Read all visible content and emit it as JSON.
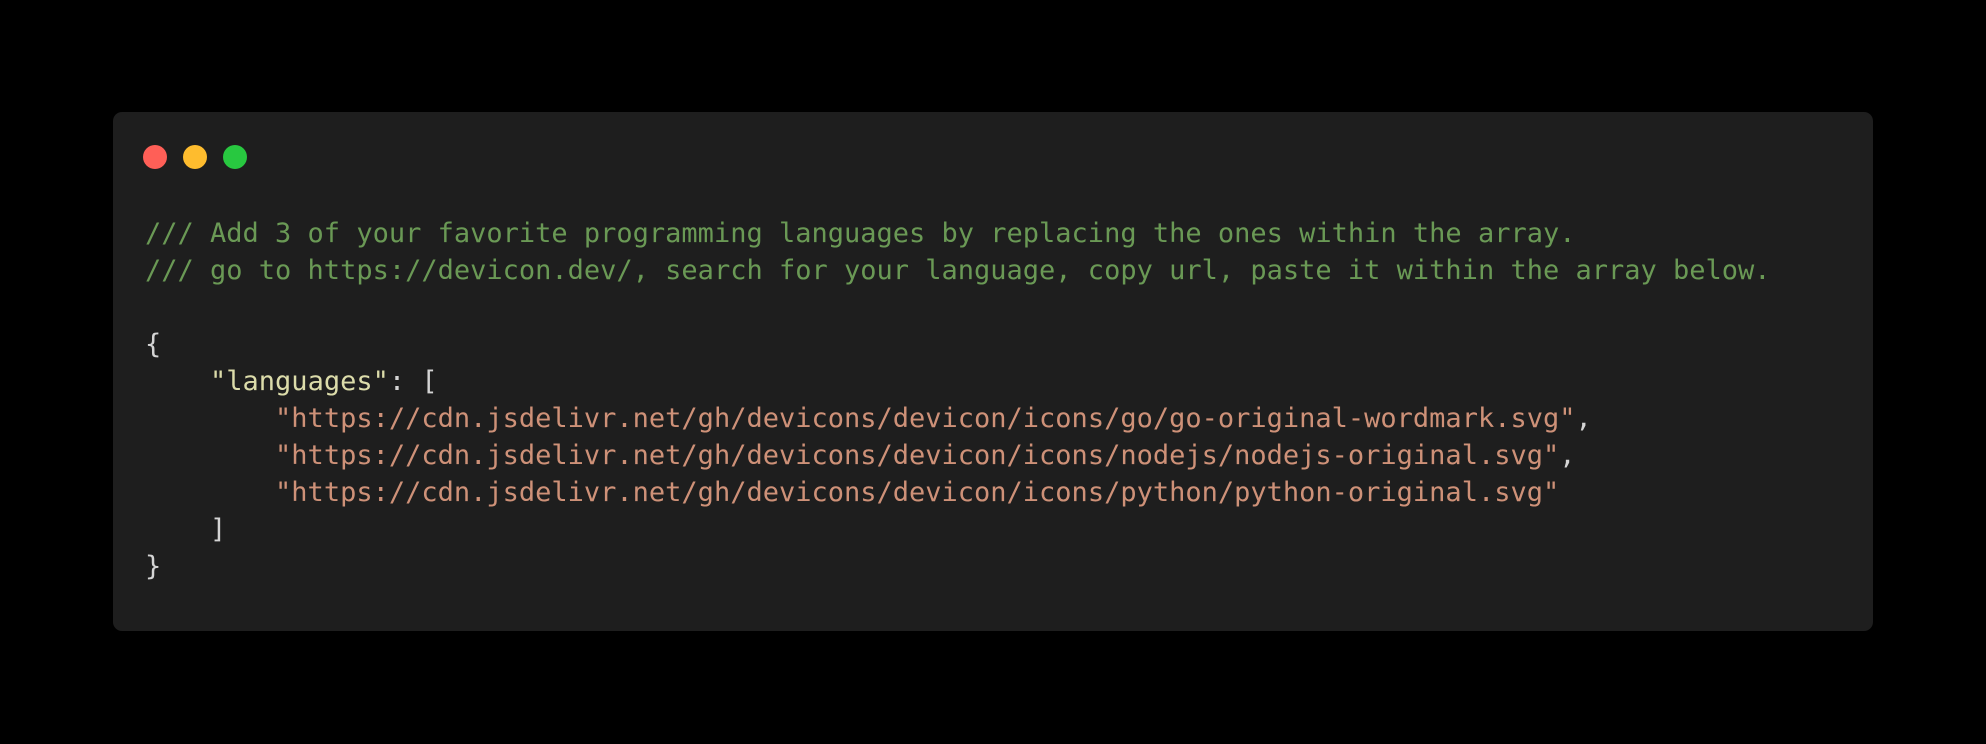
{
  "colors": {
    "page_background": "#000000",
    "window_background": "#1e1e1e",
    "close": "#ff5f57",
    "minimize": "#febc2e",
    "zoom": "#28c840",
    "comment": "#6a9955",
    "key": "#dcdcaa",
    "string": "#ce9178",
    "punctuation": "#d4d4d4"
  },
  "code": {
    "comment_1": "/// Add 3 of your favorite programming languages by replacing the ones within the array.",
    "comment_2": "/// go to https://devicon.dev/, search for your language, copy url, paste it within the array below.",
    "open_brace": "{",
    "indent_1": "    ",
    "key": "\"languages\"",
    "key_sep": ": [",
    "indent_2": "        ",
    "urls": [
      "\"https://cdn.jsdelivr.net/gh/devicons/devicon/icons/go/go-original-wordmark.svg\"",
      "\"https://cdn.jsdelivr.net/gh/devicons/devicon/icons/nodejs/nodejs-original.svg\"",
      "\"https://cdn.jsdelivr.net/gh/devicons/devicon/icons/python/python-original.svg\""
    ],
    "comma": ",",
    "close_bracket": "]",
    "close_brace": "}"
  }
}
